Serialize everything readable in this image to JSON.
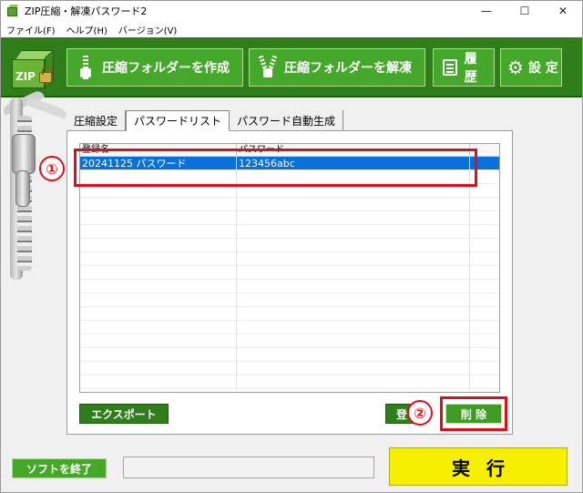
{
  "window": {
    "title": "ZIP圧縮・解凍パスワード2",
    "controls": [
      "—",
      "☐",
      "✕"
    ]
  },
  "menu": [
    "ファイル(F)",
    "ヘルプ(H)",
    "バージョン(V)"
  ],
  "logo": {
    "label": "ZIP"
  },
  "toolbar": {
    "compress": "圧縮フォルダーを作成",
    "extract": "圧縮フォルダーを解凍",
    "history": "履 歴",
    "settings": "設 定"
  },
  "tabs": [
    "圧縮設定",
    "パスワードリスト",
    "パスワード自動生成"
  ],
  "list": {
    "columns": [
      "登録名",
      "パスワード",
      ""
    ],
    "rows": [
      {
        "name": "20241125 パスワード",
        "password": "123456abc",
        "selected": true
      }
    ]
  },
  "buttons": {
    "export": "エクスポート",
    "register": "登",
    "delete": "削 除"
  },
  "annotations": {
    "one": "①",
    "two": "②"
  },
  "bottom": {
    "quit": "ソフトを終了",
    "run": "実行"
  },
  "colors": {
    "toolbar": "#2f7d1b",
    "accent_button": "#45a82a",
    "selected_row": "#0a6fd6",
    "annotation": "#d8121b",
    "run": "#f7ef00"
  }
}
